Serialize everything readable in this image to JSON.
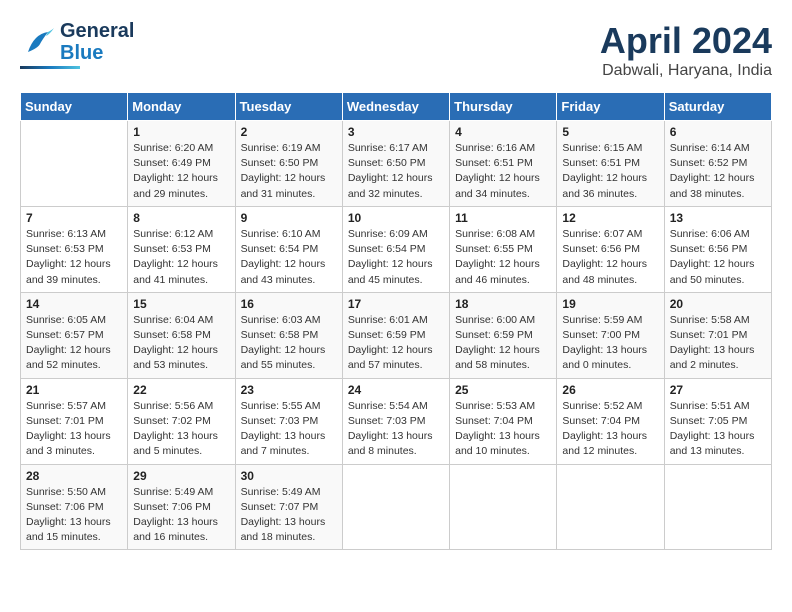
{
  "header": {
    "logo_line1": "General",
    "logo_line2": "Blue",
    "title": "April 2024",
    "location": "Dabwali, Haryana, India"
  },
  "weekdays": [
    "Sunday",
    "Monday",
    "Tuesday",
    "Wednesday",
    "Thursday",
    "Friday",
    "Saturday"
  ],
  "weeks": [
    [
      {
        "day": "",
        "info": ""
      },
      {
        "day": "1",
        "info": "Sunrise: 6:20 AM\nSunset: 6:49 PM\nDaylight: 12 hours\nand 29 minutes."
      },
      {
        "day": "2",
        "info": "Sunrise: 6:19 AM\nSunset: 6:50 PM\nDaylight: 12 hours\nand 31 minutes."
      },
      {
        "day": "3",
        "info": "Sunrise: 6:17 AM\nSunset: 6:50 PM\nDaylight: 12 hours\nand 32 minutes."
      },
      {
        "day": "4",
        "info": "Sunrise: 6:16 AM\nSunset: 6:51 PM\nDaylight: 12 hours\nand 34 minutes."
      },
      {
        "day": "5",
        "info": "Sunrise: 6:15 AM\nSunset: 6:51 PM\nDaylight: 12 hours\nand 36 minutes."
      },
      {
        "day": "6",
        "info": "Sunrise: 6:14 AM\nSunset: 6:52 PM\nDaylight: 12 hours\nand 38 minutes."
      }
    ],
    [
      {
        "day": "7",
        "info": "Sunrise: 6:13 AM\nSunset: 6:53 PM\nDaylight: 12 hours\nand 39 minutes."
      },
      {
        "day": "8",
        "info": "Sunrise: 6:12 AM\nSunset: 6:53 PM\nDaylight: 12 hours\nand 41 minutes."
      },
      {
        "day": "9",
        "info": "Sunrise: 6:10 AM\nSunset: 6:54 PM\nDaylight: 12 hours\nand 43 minutes."
      },
      {
        "day": "10",
        "info": "Sunrise: 6:09 AM\nSunset: 6:54 PM\nDaylight: 12 hours\nand 45 minutes."
      },
      {
        "day": "11",
        "info": "Sunrise: 6:08 AM\nSunset: 6:55 PM\nDaylight: 12 hours\nand 46 minutes."
      },
      {
        "day": "12",
        "info": "Sunrise: 6:07 AM\nSunset: 6:56 PM\nDaylight: 12 hours\nand 48 minutes."
      },
      {
        "day": "13",
        "info": "Sunrise: 6:06 AM\nSunset: 6:56 PM\nDaylight: 12 hours\nand 50 minutes."
      }
    ],
    [
      {
        "day": "14",
        "info": "Sunrise: 6:05 AM\nSunset: 6:57 PM\nDaylight: 12 hours\nand 52 minutes."
      },
      {
        "day": "15",
        "info": "Sunrise: 6:04 AM\nSunset: 6:58 PM\nDaylight: 12 hours\nand 53 minutes."
      },
      {
        "day": "16",
        "info": "Sunrise: 6:03 AM\nSunset: 6:58 PM\nDaylight: 12 hours\nand 55 minutes."
      },
      {
        "day": "17",
        "info": "Sunrise: 6:01 AM\nSunset: 6:59 PM\nDaylight: 12 hours\nand 57 minutes."
      },
      {
        "day": "18",
        "info": "Sunrise: 6:00 AM\nSunset: 6:59 PM\nDaylight: 12 hours\nand 58 minutes."
      },
      {
        "day": "19",
        "info": "Sunrise: 5:59 AM\nSunset: 7:00 PM\nDaylight: 13 hours\nand 0 minutes."
      },
      {
        "day": "20",
        "info": "Sunrise: 5:58 AM\nSunset: 7:01 PM\nDaylight: 13 hours\nand 2 minutes."
      }
    ],
    [
      {
        "day": "21",
        "info": "Sunrise: 5:57 AM\nSunset: 7:01 PM\nDaylight: 13 hours\nand 3 minutes."
      },
      {
        "day": "22",
        "info": "Sunrise: 5:56 AM\nSunset: 7:02 PM\nDaylight: 13 hours\nand 5 minutes."
      },
      {
        "day": "23",
        "info": "Sunrise: 5:55 AM\nSunset: 7:03 PM\nDaylight: 13 hours\nand 7 minutes."
      },
      {
        "day": "24",
        "info": "Sunrise: 5:54 AM\nSunset: 7:03 PM\nDaylight: 13 hours\nand 8 minutes."
      },
      {
        "day": "25",
        "info": "Sunrise: 5:53 AM\nSunset: 7:04 PM\nDaylight: 13 hours\nand 10 minutes."
      },
      {
        "day": "26",
        "info": "Sunrise: 5:52 AM\nSunset: 7:04 PM\nDaylight: 13 hours\nand 12 minutes."
      },
      {
        "day": "27",
        "info": "Sunrise: 5:51 AM\nSunset: 7:05 PM\nDaylight: 13 hours\nand 13 minutes."
      }
    ],
    [
      {
        "day": "28",
        "info": "Sunrise: 5:50 AM\nSunset: 7:06 PM\nDaylight: 13 hours\nand 15 minutes."
      },
      {
        "day": "29",
        "info": "Sunrise: 5:49 AM\nSunset: 7:06 PM\nDaylight: 13 hours\nand 16 minutes."
      },
      {
        "day": "30",
        "info": "Sunrise: 5:49 AM\nSunset: 7:07 PM\nDaylight: 13 hours\nand 18 minutes."
      },
      {
        "day": "",
        "info": ""
      },
      {
        "day": "",
        "info": ""
      },
      {
        "day": "",
        "info": ""
      },
      {
        "day": "",
        "info": ""
      }
    ]
  ]
}
